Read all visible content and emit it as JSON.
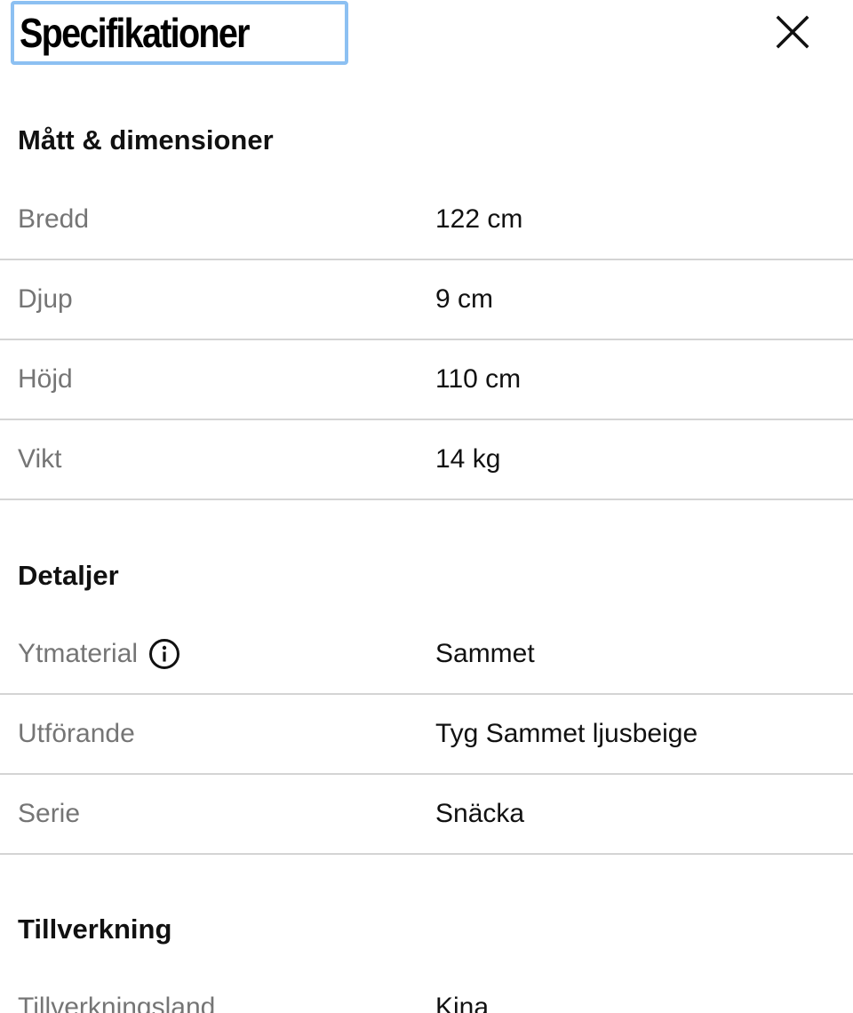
{
  "header": {
    "title": "Specifikationer",
    "close_icon": "close-icon"
  },
  "sections": [
    {
      "heading": "Mått & dimensioner",
      "rows": [
        {
          "label": "Bredd",
          "value": "122 cm"
        },
        {
          "label": "Djup",
          "value": "9 cm"
        },
        {
          "label": "Höjd",
          "value": "110 cm"
        },
        {
          "label": "Vikt",
          "value": "14 kg"
        }
      ]
    },
    {
      "heading": "Detaljer",
      "rows": [
        {
          "label": "Ytmaterial",
          "value": "Sammet",
          "icon": "info-icon"
        },
        {
          "label": "Utförande",
          "value": "Tyg Sammet ljusbeige"
        },
        {
          "label": "Serie",
          "value": "Snäcka"
        }
      ]
    },
    {
      "heading": "Tillverkning",
      "rows": [
        {
          "label": "Tillverkningsland",
          "value": "Kina"
        }
      ]
    }
  ],
  "colors": {
    "focus_outline": "#8cc0f2",
    "label_text": "#757575",
    "divider": "#d4d4d4"
  }
}
